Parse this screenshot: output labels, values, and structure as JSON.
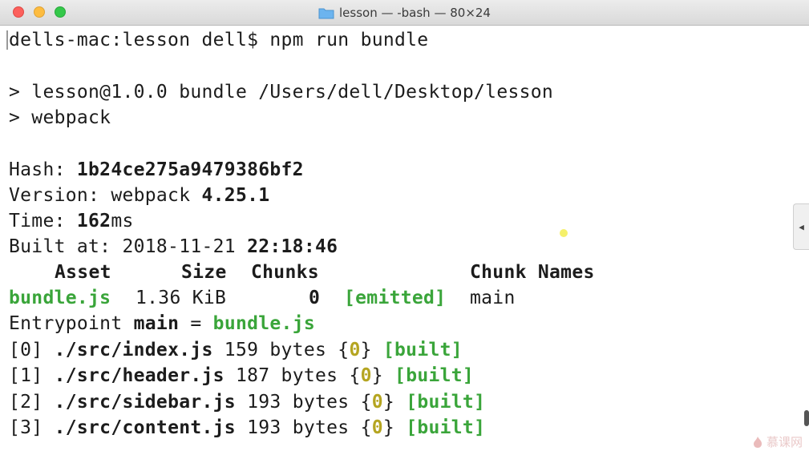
{
  "window": {
    "title": "lesson — -bash — 80×24",
    "icons": {
      "folder": "folder-icon"
    },
    "colors": {
      "close": "#fc605c",
      "minimize": "#fdbc40",
      "maximize": "#34c84a"
    }
  },
  "terminal": {
    "colors": {
      "green": "#3aa53a",
      "yellow": "#b5a521"
    },
    "prompt": {
      "host": "dells-mac:lesson dell$ ",
      "command": "npm run bundle"
    },
    "script": {
      "line1": "> lesson@1.0.0 bundle /Users/dell/Desktop/lesson",
      "line2": "> webpack"
    },
    "hash": {
      "label": "Hash: ",
      "value": "1b24ce275a9479386bf2"
    },
    "version": {
      "label": "Version: webpack ",
      "value": "4.25.1"
    },
    "time": {
      "label": "Time: ",
      "value": "162",
      "unit": "ms"
    },
    "built_at": {
      "label": "Built at: 2018-11-21 ",
      "value": "22:18:46"
    },
    "table": {
      "headers": {
        "asset": "Asset",
        "size": "Size",
        "chunks": "Chunks",
        "chunk_names": "Chunk Names"
      },
      "row": {
        "asset": "bundle.js",
        "size": "1.36 KiB",
        "chunks": "0",
        "status": "[emitted]",
        "chunk_names": "main"
      }
    },
    "entrypoint": {
      "label": "Entrypoint ",
      "name": "main",
      "eq": " = ",
      "file": "bundle.js"
    },
    "modules": [
      {
        "id": "[0] ",
        "path": "./src/index.js",
        "size": " 159 bytes ",
        "chunk_open": "{",
        "chunk": "0",
        "chunk_close": "} ",
        "status": "[built]"
      },
      {
        "id": "[1] ",
        "path": "./src/header.js",
        "size": " 187 bytes ",
        "chunk_open": "{",
        "chunk": "0",
        "chunk_close": "} ",
        "status": "[built]"
      },
      {
        "id": "[2] ",
        "path": "./src/sidebar.js",
        "size": " 193 bytes ",
        "chunk_open": "{",
        "chunk": "0",
        "chunk_close": "} ",
        "status": "[built]"
      },
      {
        "id": "[3] ",
        "path": "./src/content.js",
        "size": " 193 bytes ",
        "chunk_open": "{",
        "chunk": "0",
        "chunk_close": "} ",
        "status": "[built]"
      }
    ]
  },
  "watermark": {
    "text": "慕课网",
    "icon": "flame-icon"
  }
}
